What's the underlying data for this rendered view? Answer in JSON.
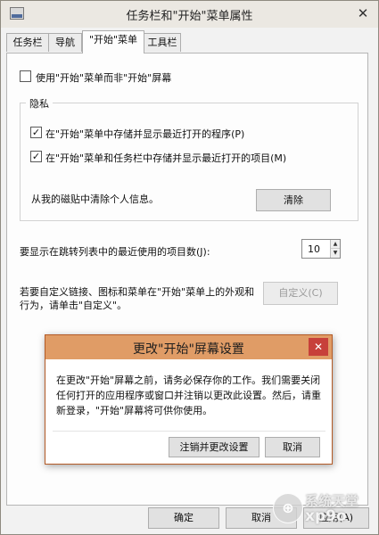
{
  "window": {
    "title": "任务栏和\"开始\"菜单属性",
    "close_glyph": "✕",
    "app_icon": "taskbar-icon"
  },
  "tabs": [
    {
      "label": "任务栏"
    },
    {
      "label": "导航"
    },
    {
      "label": "\"开始\"菜单"
    },
    {
      "label": "工具栏"
    }
  ],
  "start_tab": {
    "use_start_menu": {
      "label": "使用\"开始\"菜单而非\"开始\"屏幕",
      "checked": false
    },
    "privacy": {
      "title": "隐私",
      "store_programs": {
        "label": "在\"开始\"菜单中存储并显示最近打开的程序(P)",
        "checked": true
      },
      "store_items": {
        "label": "在\"开始\"菜单和任务栏中存储并显示最近打开的项目(M)",
        "checked": true
      },
      "clear_text": "从我的磁贴中清除个人信息。",
      "clear_button": "清除"
    },
    "recent_items": {
      "label": "要显示在跳转列表中的最近使用的项目数(J):",
      "value": "10",
      "up_glyph": "▲",
      "down_glyph": "▼"
    },
    "customize": {
      "text_line1": "若要自定义链接、图标和菜单在\"开始\"菜单上的外观和",
      "text_line2": "行为，请单击\"自定义\"。",
      "button": "自定义(C)"
    }
  },
  "footer": {
    "ok": "确定",
    "cancel": "取消",
    "apply": "应用(A)"
  },
  "dialog": {
    "title": "更改\"开始\"屏幕设置",
    "close_glyph": "✕",
    "message_line1": "在更改\"开始\"屏幕之前，请务必保存你的工作。我们需要关闭",
    "message_line2": "任何打开的应用程序或窗口并注销以更改此设置。然后，请重",
    "message_line3": "新登录，\"开始\"屏幕将可供你使用。",
    "confirm_button": "注销并更改设置",
    "cancel_button": "取消"
  },
  "watermark": {
    "line1": "系统天堂",
    "line2": "xp9o",
    "logo_glyph": "⊕"
  },
  "colors": {
    "dialog_title_bg": "#e09c66",
    "dialog_close_bg": "#c7403a"
  }
}
